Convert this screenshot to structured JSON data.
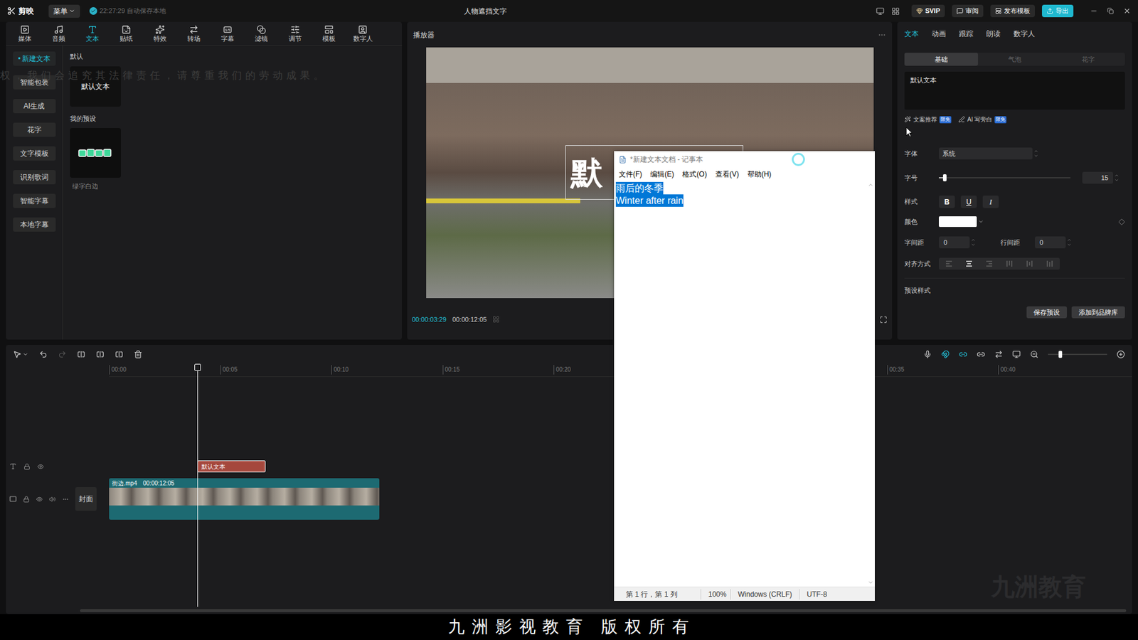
{
  "app": {
    "logo": "剪映",
    "menu": "菜单",
    "autosave": "22:27:29 自动保存本地",
    "project_title": "人物遮挡文字",
    "svip": "SVIP",
    "review": "审阅",
    "publish": "发布模板",
    "export": "导出"
  },
  "toolbar": [
    {
      "label": "媒体",
      "selected": false
    },
    {
      "label": "音频",
      "selected": false
    },
    {
      "label": "文本",
      "selected": true
    },
    {
      "label": "贴纸",
      "selected": false
    },
    {
      "label": "特效",
      "selected": false
    },
    {
      "label": "转场",
      "selected": false
    },
    {
      "label": "字幕",
      "selected": false
    },
    {
      "label": "滤镜",
      "selected": false
    },
    {
      "label": "调节",
      "selected": false
    },
    {
      "label": "模板",
      "selected": false
    },
    {
      "label": "数字人",
      "selected": false
    }
  ],
  "sidebar": {
    "bullet": "•",
    "items": [
      {
        "label": "新建文本",
        "selected": true
      },
      {
        "label": "智能包装",
        "selected": false
      },
      {
        "label": "AI生成",
        "selected": false
      },
      {
        "label": "花字",
        "selected": false
      },
      {
        "label": "文字模板",
        "selected": false
      },
      {
        "label": "识别歌词",
        "selected": false
      },
      {
        "label": "智能字幕",
        "selected": false
      },
      {
        "label": "本地字幕",
        "selected": false
      }
    ]
  },
  "library": [
    {
      "title": "默认",
      "cards": [
        {
          "label": "默认文本",
          "kind": "text"
        }
      ]
    },
    {
      "title": "我的预设",
      "cards": [
        {
          "label": "绿字白边",
          "kind": "preset"
        }
      ]
    }
  ],
  "player": {
    "title": "播放器",
    "preview_text": "默",
    "current_time": "00:00:03:29",
    "total_time": "00:00:12:05"
  },
  "inspector": {
    "tabs": [
      {
        "label": "文本",
        "selected": true
      },
      {
        "label": "动画",
        "selected": false
      },
      {
        "label": "跟踪",
        "selected": false
      },
      {
        "label": "朗读",
        "selected": false
      },
      {
        "label": "数字人",
        "selected": false
      }
    ],
    "subtabs": [
      {
        "label": "基础",
        "selected": true
      },
      {
        "label": "气泡",
        "selected": false
      },
      {
        "label": "花字",
        "selected": false
      }
    ],
    "text_value": "默认文本",
    "actions": [
      {
        "label": "文案推荐",
        "badge": "限免"
      },
      {
        "label": "AI 写旁白",
        "badge": "限免"
      }
    ],
    "font": {
      "label": "字体",
      "value": "系统"
    },
    "size": {
      "label": "字号",
      "value": "15",
      "level": 0.03
    },
    "style": {
      "label": "样式",
      "buttons": [
        "B",
        "U",
        "I"
      ]
    },
    "color": {
      "label": "颜色",
      "value": "#ffffff"
    },
    "spacing": [
      {
        "label": "字间距",
        "value": "0"
      },
      {
        "label": "行间距",
        "value": "0"
      }
    ],
    "align": {
      "label": "对齐方式",
      "options": [
        {
          "selected": false
        },
        {
          "selected": true
        },
        {
          "selected": false
        },
        {
          "selected": false
        },
        {
          "selected": false
        },
        {
          "selected": false
        }
      ]
    },
    "preset_label": "预设样式",
    "buttons": [
      "保存预设",
      "添加到品牌库"
    ]
  },
  "timeline": {
    "ticks": [
      "00:00",
      "00:05",
      "00:10",
      "00:15",
      "00:20",
      "00:35",
      "00:40"
    ],
    "text_track": {
      "clips": [
        {
          "label": "默认文本",
          "start_seconds": 3.97,
          "duration_seconds": 3.07,
          "selected": true,
          "color": "#a5473c"
        }
      ]
    },
    "video_track": {
      "cover": "封面",
      "clips": [
        {
          "label": "街边.mp4",
          "duration_label": "00:00:12:05",
          "start_seconds": 0,
          "selected": false,
          "color": "#1d6a72"
        }
      ]
    }
  },
  "notepad": {
    "title": "*新建文本文档 - 记事本",
    "menus": [
      "文件(F)",
      "编辑(E)",
      "格式(O)",
      "查看(V)",
      "帮助(H)"
    ],
    "lines": [
      {
        "text": "雨后的冬季",
        "selected": true
      },
      {
        "text": "Winter after rain",
        "selected": true
      }
    ],
    "status": [
      "第 1 行，第 1 列",
      "100%",
      "Windows (CRLF)",
      "UTF-8"
    ]
  },
  "watermarks": {
    "notice": "权，我们会追究其法律责任，请尊重我们的劳动成果。",
    "brand": "九洲教育",
    "footer": "九 洲 影 视 教 育   版 权 所 有"
  }
}
